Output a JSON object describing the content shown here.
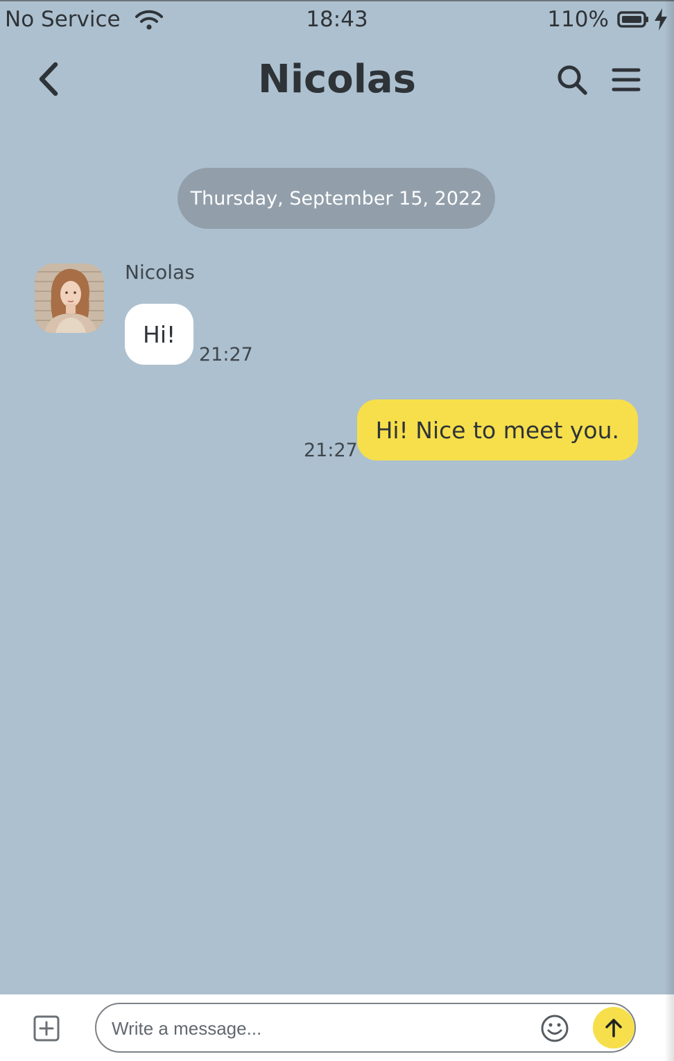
{
  "status_bar": {
    "carrier": "No Service",
    "time": "18:43",
    "battery": "110%"
  },
  "header": {
    "title": "Nicolas",
    "icons": {
      "back": "chevron-left-icon",
      "search": "search-icon",
      "menu": "hamburger-menu-icon"
    }
  },
  "chat": {
    "date_divider": "Thursday, September 15, 2022",
    "messages": [
      {
        "direction": "incoming",
        "sender": "Nicolas",
        "text": "Hi!",
        "time": "21:27"
      },
      {
        "direction": "outgoing",
        "text": "Hi! Nice to meet you.",
        "time": "21:27"
      }
    ]
  },
  "composer": {
    "placeholder": "Write a message...",
    "icons": {
      "attach": "plus-square-icon",
      "emoji": "smiley-icon",
      "send": "arrow-up-icon"
    }
  },
  "colors": {
    "background": "#adc0cf",
    "outgoing_bubble": "#f6df4b",
    "incoming_bubble": "#ffffff",
    "date_pill": "#929fab",
    "text": "#2e3338"
  }
}
